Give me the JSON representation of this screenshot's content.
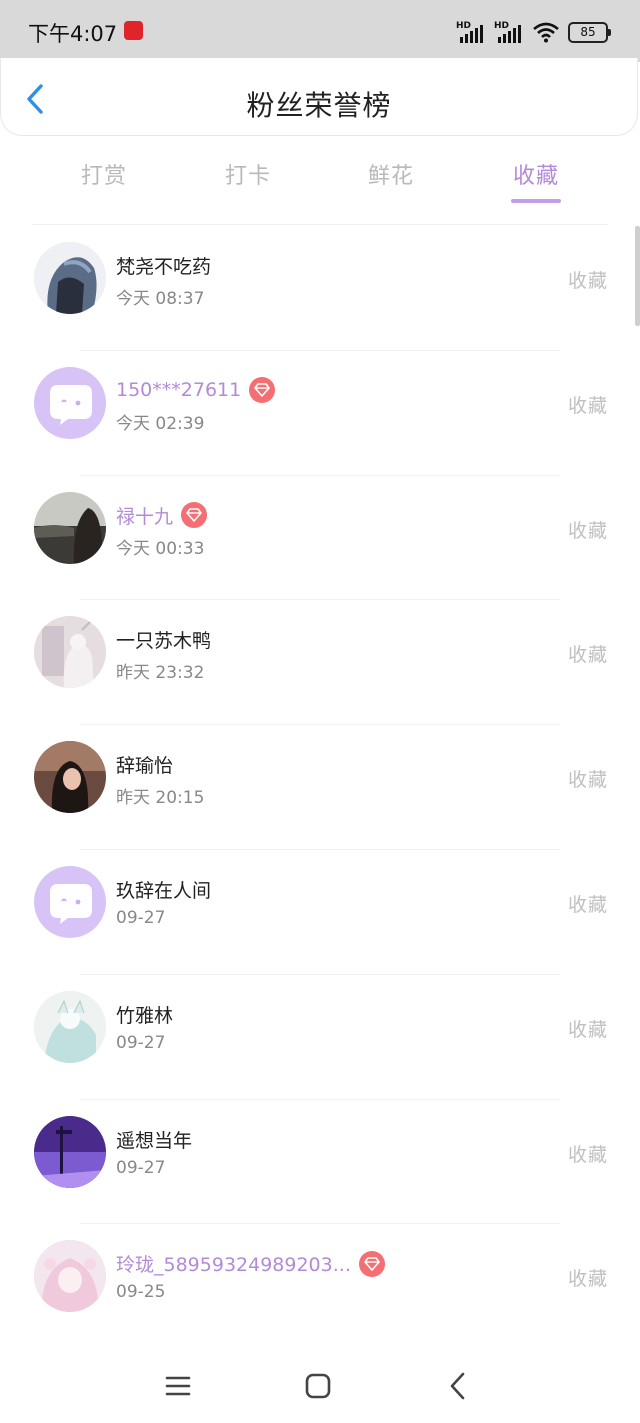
{
  "status_bar": {
    "time": "下午4:07",
    "signal1": "HD",
    "signal2": "HD",
    "battery": "85"
  },
  "header": {
    "title": "粉丝荣誉榜"
  },
  "tabs": [
    {
      "label": "打赏",
      "active": false
    },
    {
      "label": "打卡",
      "active": false
    },
    {
      "label": "鲜花",
      "active": false
    },
    {
      "label": "收藏",
      "active": true
    }
  ],
  "rows": [
    {
      "name": "梵尧不吃药",
      "time": "今天 08:37",
      "action": "收藏",
      "vip": false,
      "avatar": "photo-dark-hair"
    },
    {
      "name": "150***27611",
      "time": "今天 02:39",
      "action": "收藏",
      "vip": true,
      "avatar": "default-chat"
    },
    {
      "name": "禄十九",
      "time": "今天 00:33",
      "action": "收藏",
      "vip": true,
      "avatar": "photo-landscape"
    },
    {
      "name": "一只苏木鸭",
      "time": "昨天 23:32",
      "action": "收藏",
      "vip": false,
      "avatar": "photo-anime-light"
    },
    {
      "name": "辞瑜怡",
      "time": "昨天 20:15",
      "action": "收藏",
      "vip": false,
      "avatar": "photo-girl-warm"
    },
    {
      "name": "玖辞在人间",
      "time": "09-27",
      "action": "收藏",
      "vip": false,
      "avatar": "default-chat"
    },
    {
      "name": "竹雅林",
      "time": "09-27",
      "action": "收藏",
      "vip": false,
      "avatar": "photo-anime-cyan"
    },
    {
      "name": "遥想当年",
      "time": "09-27",
      "action": "收藏",
      "vip": false,
      "avatar": "photo-purple-city"
    },
    {
      "name": "玲珑_58959324989203...",
      "time": "09-25",
      "action": "收藏",
      "vip": true,
      "avatar": "photo-anime-pink"
    }
  ],
  "colors": {
    "accent": "#b38ad8",
    "badge": "#f36f73",
    "back": "#2e8fe8"
  }
}
